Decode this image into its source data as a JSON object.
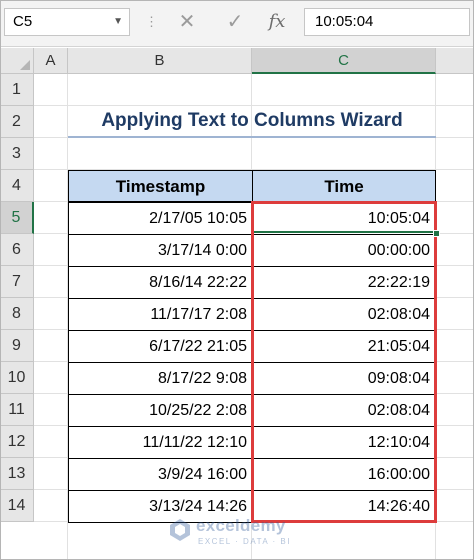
{
  "formula_bar": {
    "name_box": "C5",
    "cancel_icon": "x-icon",
    "enter_icon": "check-icon",
    "function_icon_label": "fx",
    "content": "10:05:04"
  },
  "columns": [
    "A",
    "B",
    "C"
  ],
  "rows": [
    "1",
    "2",
    "3",
    "4",
    "5",
    "6",
    "7",
    "8",
    "9",
    "10",
    "11",
    "12",
    "13",
    "14"
  ],
  "active": {
    "column": "C",
    "row": "5"
  },
  "sheet": {
    "title": "Applying Text to Columns Wizard",
    "headers": {
      "timestamp": "Timestamp",
      "time": "Time"
    },
    "data": [
      {
        "timestamp": "2/17/05 10:05",
        "time": "10:05:04"
      },
      {
        "timestamp": "3/17/14 0:00",
        "time": "00:00:00"
      },
      {
        "timestamp": "8/16/14 22:22",
        "time": "22:22:19"
      },
      {
        "timestamp": "11/17/17 2:08",
        "time": "02:08:04"
      },
      {
        "timestamp": "6/17/22 21:05",
        "time": "21:05:04"
      },
      {
        "timestamp": "8/17/22 9:08",
        "time": "09:08:04"
      },
      {
        "timestamp": "10/25/22 2:08",
        "time": "02:08:04"
      },
      {
        "timestamp": "11/11/22 12:10",
        "time": "12:10:04"
      },
      {
        "timestamp": "3/9/24 16:00",
        "time": "16:00:00"
      },
      {
        "timestamp": "3/13/24 14:26",
        "time": "14:26:40"
      }
    ]
  },
  "colors": {
    "header_fill": "#c5d9f1",
    "highlight_border": "#dd3c3c",
    "excel_green": "#217346",
    "title_text": "#1f3b64"
  },
  "watermark": {
    "name": "exceldemy",
    "tagline": "EXCEL · DATA · BI"
  }
}
